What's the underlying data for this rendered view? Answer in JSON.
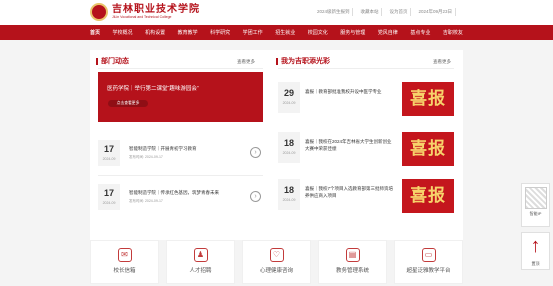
{
  "header": {
    "school_name": "吉林职业技术学院",
    "school_name_en": "JiLin Vocational and Technical College",
    "top_links": [
      "2024级新生报到",
      "收藏本站",
      "设为首页",
      "2024年09月23日"
    ]
  },
  "nav": [
    "首页",
    "学校概况",
    "机构设置",
    "教育教学",
    "科学研究",
    "学团工作",
    "招生就业",
    "校园文化",
    "服务与管理",
    "党风自律",
    "基点专业",
    "吉职校友"
  ],
  "news_section": {
    "title": "部门动态",
    "more": "查看更多",
    "hero_text": "医药学院｜举行第二课堂“趣味游园会”",
    "hero_button": "点击查看更多",
    "items": [
      {
        "day": "17",
        "ym": "2024-09",
        "title": "智能制造学院｜开展青初学习教育",
        "date": "发布时间: 2024-09-17"
      },
      {
        "day": "17",
        "ym": "2024-09",
        "title": "智能制造学院｜传承红色基因，筑梦青春未来",
        "date": "发布时间: 2024-09-17"
      }
    ]
  },
  "showcase": {
    "title": "我为吉职添光彩",
    "more": "查看更多",
    "items": [
      {
        "day": "29",
        "ym": "2024-09",
        "title": "喜报｜教育部批准我校升设中医学专业",
        "thumb": "喜报"
      },
      {
        "day": "18",
        "ym": "2024-09",
        "title": "喜报｜我校在2024年吉林省大学生创新创业大赛中荣获佳绩",
        "thumb": "喜报"
      },
      {
        "day": "18",
        "ym": "2024-09",
        "title": "喜报｜我校7个项目入选教育部第三批师资培养供应商入项目",
        "thumb": "喜报"
      }
    ]
  },
  "services": [
    {
      "label": "校长信箱",
      "icon": "mail-icon",
      "glyph": "✉"
    },
    {
      "label": "人才招聘",
      "icon": "person-icon",
      "glyph": "♟"
    },
    {
      "label": "心理健康咨询",
      "icon": "heart-icon",
      "glyph": "♡"
    },
    {
      "label": "教务管理系统",
      "icon": "book-icon",
      "glyph": "▤"
    },
    {
      "label": "超星泛雅教学平台",
      "icon": "monitor-icon",
      "glyph": "▭"
    }
  ],
  "float": {
    "wechat_label": "智能IP",
    "top_label": "置顶"
  },
  "colors": {
    "accent": "#b5121b",
    "thumb_text": "#f7d36b"
  }
}
